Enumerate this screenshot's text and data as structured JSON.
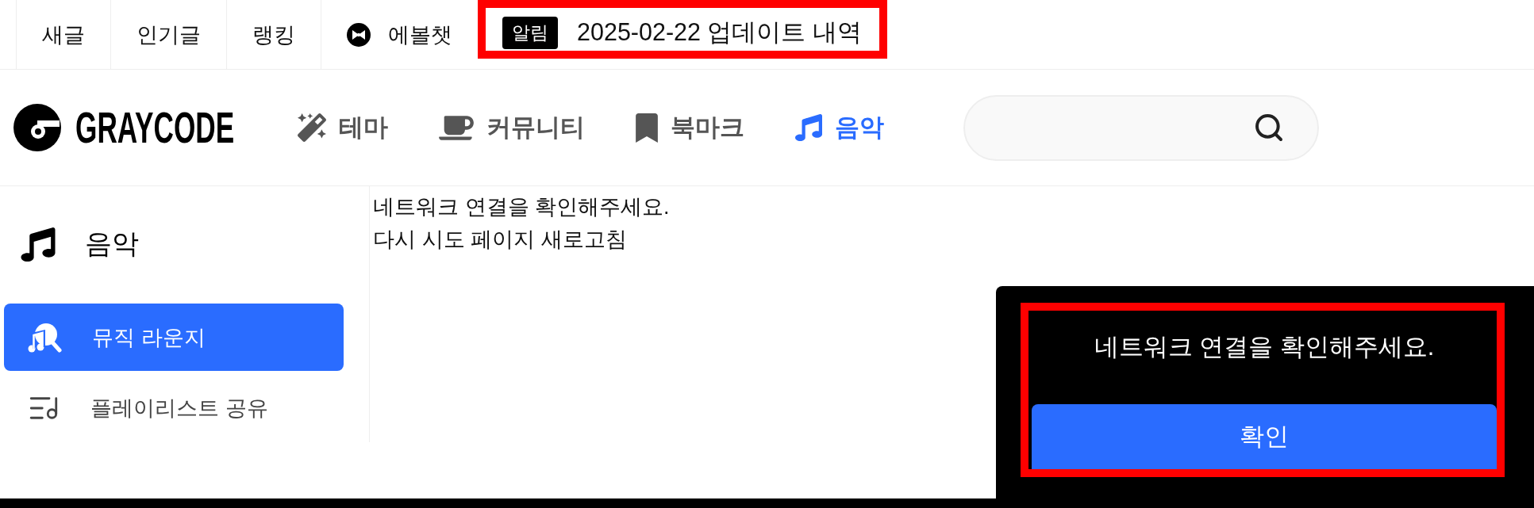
{
  "top_bar": {
    "links": [
      {
        "label": "새글"
      },
      {
        "label": "인기글"
      },
      {
        "label": "랭킹"
      },
      {
        "label": "에볼챗"
      }
    ],
    "notice": {
      "badge": "알림",
      "text": "2025-02-22 업데이트 내역",
      "highlighted": true
    }
  },
  "header": {
    "logo": "GRAYCODE",
    "nav": [
      {
        "label": "테마",
        "selected": false
      },
      {
        "label": "커뮤니티",
        "selected": false
      },
      {
        "label": "북마크",
        "selected": false
      },
      {
        "label": "음악",
        "selected": true
      }
    ]
  },
  "sidebar": {
    "title": "음악",
    "items": [
      {
        "label": "뮤직 라운지",
        "selected": true
      },
      {
        "label": "플레이리스트 공유",
        "selected": false
      }
    ]
  },
  "main": {
    "lines": [
      "네트워크 연결을 확인해주세요.",
      "다시 시도 페이지 새로고침"
    ]
  },
  "toast": {
    "message": "네트워크 연결을 확인해주세요.",
    "button": "확인",
    "highlighted": true
  }
}
